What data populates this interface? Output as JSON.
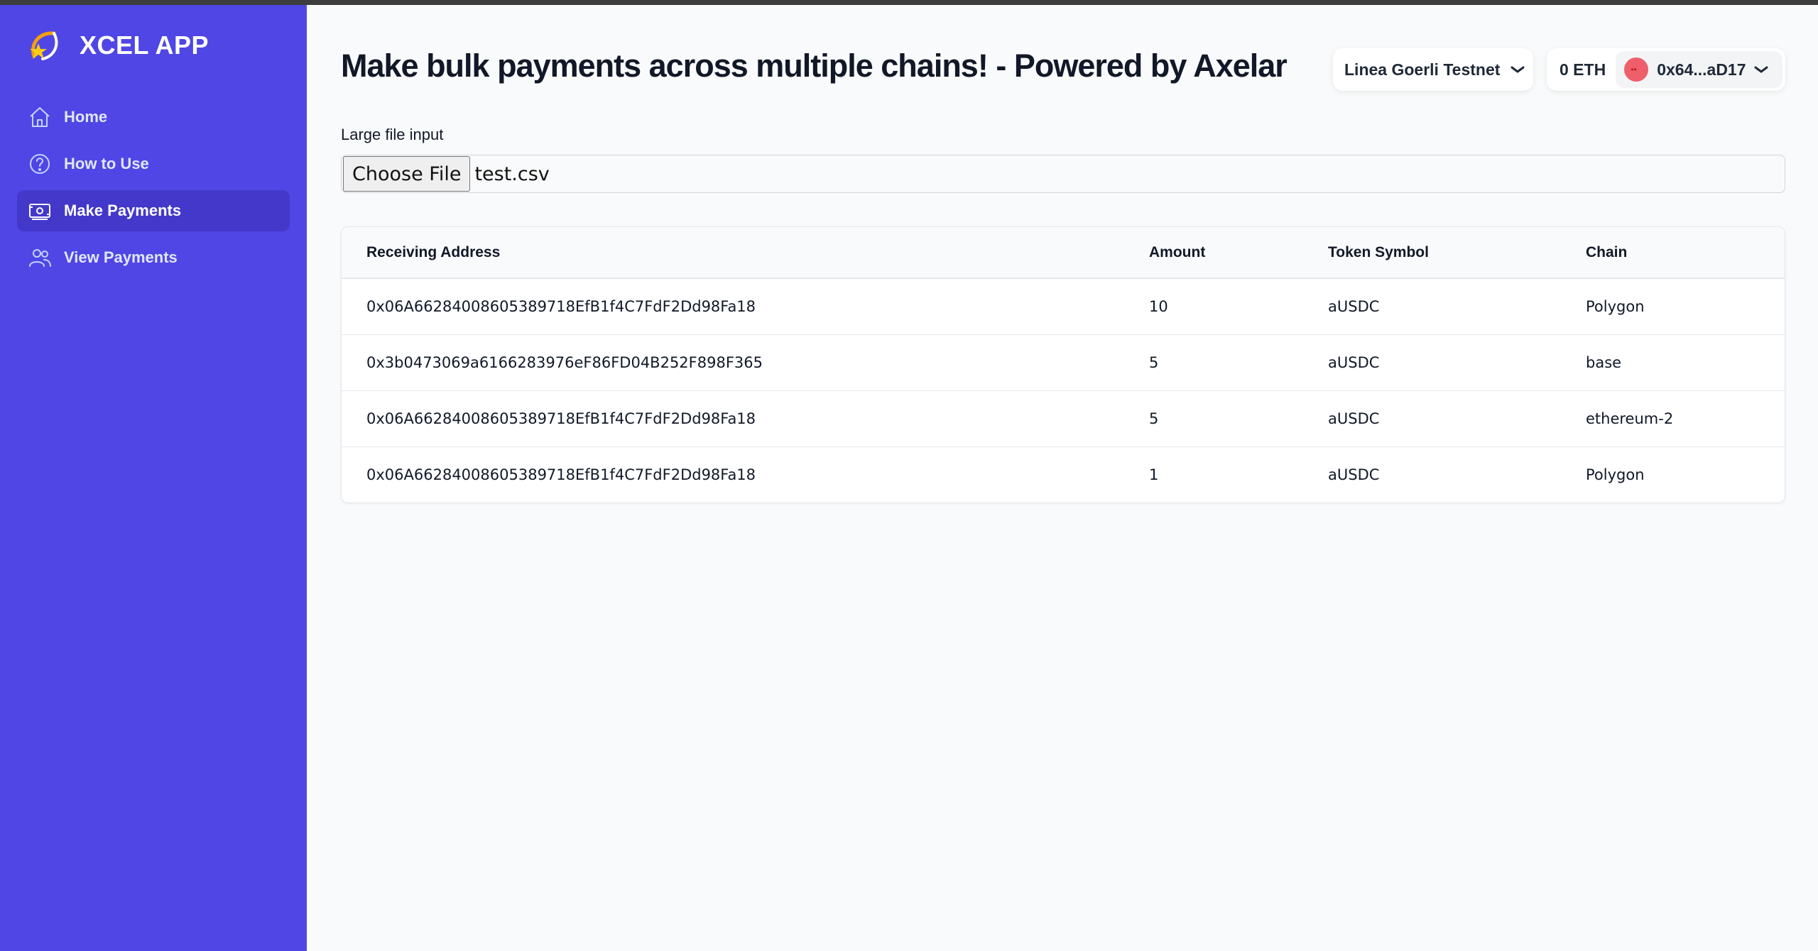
{
  "app": {
    "name": "XCEL APP"
  },
  "sidebar": {
    "items": [
      {
        "label": "Home",
        "icon": "home-icon"
      },
      {
        "label": "How to Use",
        "icon": "help-circle-icon"
      },
      {
        "label": "Make Payments",
        "icon": "banknote-icon",
        "active": true
      },
      {
        "label": "View Payments",
        "icon": "users-icon"
      }
    ]
  },
  "header": {
    "title": "Make bulk payments across multiple chains! - Powered by Axelar",
    "network": "Linea Goerli Testnet",
    "balance": "0 ETH",
    "account": "0x64...aD17"
  },
  "upload": {
    "label": "Large file input",
    "button": "Choose File",
    "file_name": "test.csv"
  },
  "table": {
    "headers": [
      "Receiving Address",
      "Amount",
      "Token Symbol",
      "Chain"
    ],
    "rows": [
      [
        "0x06A66284008605389718EfB1f4C7FdF2Dd98Fa18",
        "10",
        "aUSDC",
        "Polygon"
      ],
      [
        "0x3b0473069a6166283976eF86FD04B252F898F365",
        "5",
        "aUSDC",
        "base"
      ],
      [
        "0x06A66284008605389718EfB1f4C7FdF2Dd98Fa18",
        "5",
        "aUSDC",
        "ethereum-2"
      ],
      [
        "0x06A66284008605389718EfB1f4C7FdF2Dd98Fa18",
        "1",
        "aUSDC",
        "Polygon"
      ]
    ]
  },
  "colors": {
    "sidebar": "#4f46e5",
    "sidebar_active": "#4338ca",
    "background": "#f9fafb"
  }
}
